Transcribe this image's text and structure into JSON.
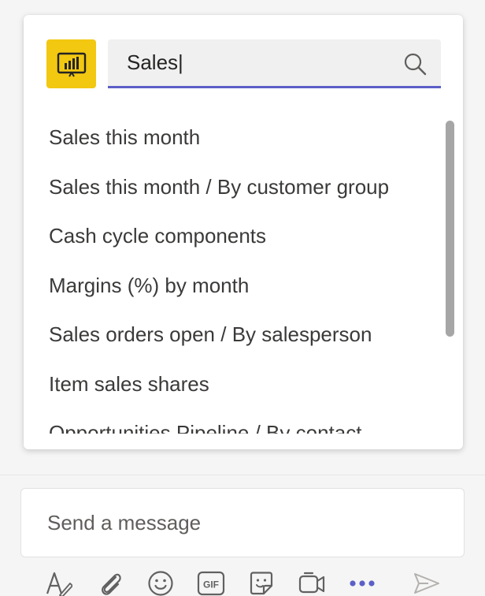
{
  "app": {
    "name": "Power BI",
    "icon": "power-bi-icon",
    "accent": "#f2c811"
  },
  "search": {
    "value": "Sales|",
    "icon": "search-icon",
    "underline_color": "#5b5fc7"
  },
  "results": [
    {
      "label": "Sales this month"
    },
    {
      "label": "Sales this month / By customer group"
    },
    {
      "label": "Cash cycle components"
    },
    {
      "label": "Margins (%) by month"
    },
    {
      "label": "Sales orders open / By salesperson"
    },
    {
      "label": "Item sales shares"
    },
    {
      "label": "Opportunities Pipeline / By contact"
    }
  ],
  "composer": {
    "placeholder": "Send a message"
  },
  "toolbar": {
    "items": [
      {
        "icon": "format-icon"
      },
      {
        "icon": "attach-icon"
      },
      {
        "icon": "emoji-icon"
      },
      {
        "icon": "gif-icon",
        "label": "GIF"
      },
      {
        "icon": "sticker-icon"
      },
      {
        "icon": "meet-now-icon"
      },
      {
        "icon": "more-options-icon"
      },
      {
        "icon": "send-icon"
      }
    ]
  }
}
